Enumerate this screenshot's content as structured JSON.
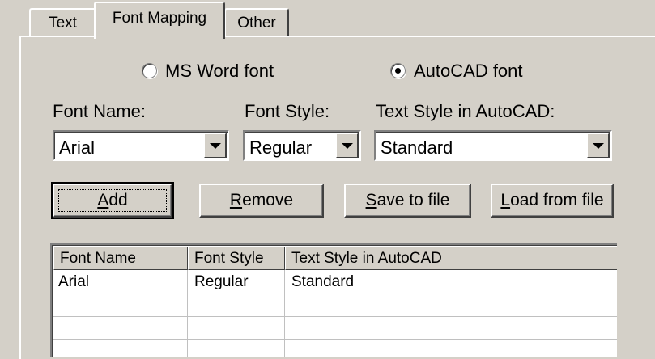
{
  "tabs": [
    {
      "label": "Text"
    },
    {
      "label": "Font Mapping"
    },
    {
      "label": "Other"
    }
  ],
  "radios": {
    "ms_word": {
      "label": "MS Word font",
      "checked": false
    },
    "autocad": {
      "label": "AutoCAD font",
      "checked": true
    }
  },
  "labels": {
    "font_name": "Font Name:",
    "font_style": "Font Style:",
    "text_style": "Text Style in AutoCAD:"
  },
  "combos": {
    "font_name": "Arial",
    "font_style": "Regular",
    "text_style": "Standard"
  },
  "buttons": {
    "add": {
      "mnemonic": "A",
      "rest": "dd"
    },
    "remove": {
      "mnemonic": "R",
      "rest": "emove"
    },
    "save": {
      "mnemonic": "S",
      "rest": "ave to file"
    },
    "load": {
      "mnemonic": "L",
      "rest": "oad from file"
    }
  },
  "table": {
    "columns": [
      "Font Name",
      "Font Style",
      "Text Style in AutoCAD"
    ],
    "rows": [
      [
        "Arial",
        "Regular",
        "Standard"
      ]
    ]
  },
  "icons": {
    "dropdown": "chevron-down-icon",
    "radio": "radio-icon"
  }
}
